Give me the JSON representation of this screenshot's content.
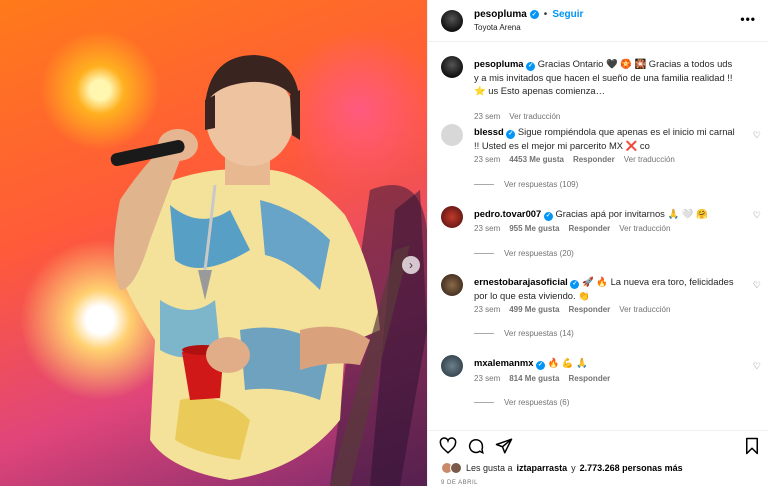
{
  "post": {
    "username": "pesopluma",
    "follow_label": "Seguir",
    "location": "Toyota Arena"
  },
  "caption": {
    "username": "pesopluma",
    "text": "Gracias Ontario 🖤 🏵️ 🎇 Gracias a todos uds y a mis invitados que hacen el sueño de una familia realidad !! ⭐ us Esto apenas comienza…",
    "time": "23 sem",
    "translate": "Ver traducción"
  },
  "comments": [
    {
      "username": "blessd",
      "text": "Sigue rompiéndola que apenas es el inicio mi carnal !! Usted es el mejor mi parcerito MX ❌ co",
      "time": "23 sem",
      "likes": "4453 Me gusta",
      "reply": "Responder",
      "translate": "Ver traducción",
      "view_replies": "Ver respuestas (109)"
    },
    {
      "username": "pedro.tovar007",
      "text": "Gracias apá por invitarnos 🙏 🤍 🤗",
      "time": "23 sem",
      "likes": "955 Me gusta",
      "reply": "Responder",
      "translate": "Ver traducción",
      "view_replies": "Ver respuestas (20)"
    },
    {
      "username": "ernestobarajasoficial",
      "text": "🚀 🔥 La nueva era toro, felicidades por lo que esta viviendo. 👏",
      "time": "23 sem",
      "likes": "499 Me gusta",
      "reply": "Responder",
      "translate": "Ver traducción",
      "view_replies": "Ver respuestas (14)"
    },
    {
      "username": "mxalemanmx",
      "text": "🔥 💪 🙏",
      "time": "23 sem",
      "likes": "814 Me gusta",
      "reply": "Responder",
      "view_replies": "Ver respuestas (6)"
    }
  ],
  "likes_line": {
    "prefix": "Les gusta a",
    "user": "iztaparrasta",
    "middle": "y",
    "count": "2.773.268 personas más"
  },
  "date": "9 DE ABRIL",
  "icons": [
    "verified-icon",
    "more-icon",
    "heart-icon",
    "comment-icon",
    "share-icon",
    "bookmark-icon",
    "chevron-right-icon"
  ],
  "colors": {
    "accent": "#0095f6",
    "muted": "#737373"
  }
}
